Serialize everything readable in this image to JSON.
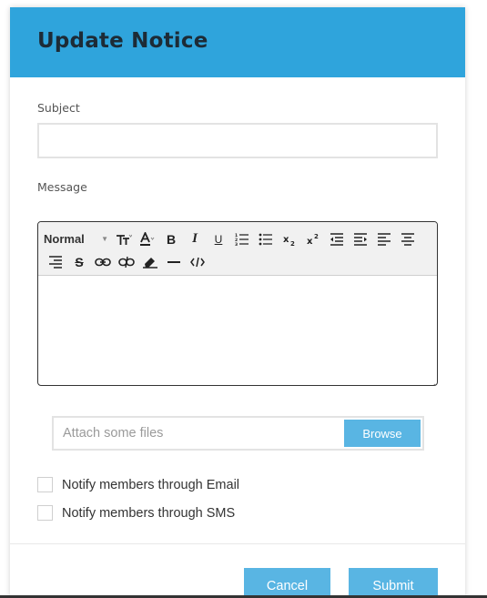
{
  "modal": {
    "title": "Update Notice"
  },
  "form": {
    "subject_label": "Subject",
    "subject_value": "",
    "message_label": "Message",
    "editor": {
      "format_select": "Normal",
      "toolbar_icons": [
        "text-size-icon",
        "font-color-icon",
        "bold-icon",
        "italic-icon",
        "underline-icon",
        "ordered-list-icon",
        "unordered-list-icon",
        "subscript-icon",
        "superscript-icon",
        "outdent-icon",
        "indent-icon",
        "align-left-icon",
        "align-center-icon",
        "align-right-icon",
        "strikethrough-icon",
        "link-icon",
        "unlink-icon",
        "eraser-icon",
        "horizontal-rule-icon",
        "code-view-icon"
      ],
      "bold_glyph": "B",
      "italic_glyph": "I",
      "underline_glyph": "U",
      "strike_glyph": "S"
    },
    "attach_placeholder": "Attach some files",
    "browse_label": "Browse",
    "notify_email_label": "Notify members through Email",
    "notify_sms_label": "Notify members through SMS"
  },
  "footer": {
    "cancel_label": "Cancel",
    "submit_label": "Submit"
  },
  "colors": {
    "header_bg": "#2fa4dc",
    "button_bg": "#59b5e3",
    "title_text": "#1d2b36"
  }
}
